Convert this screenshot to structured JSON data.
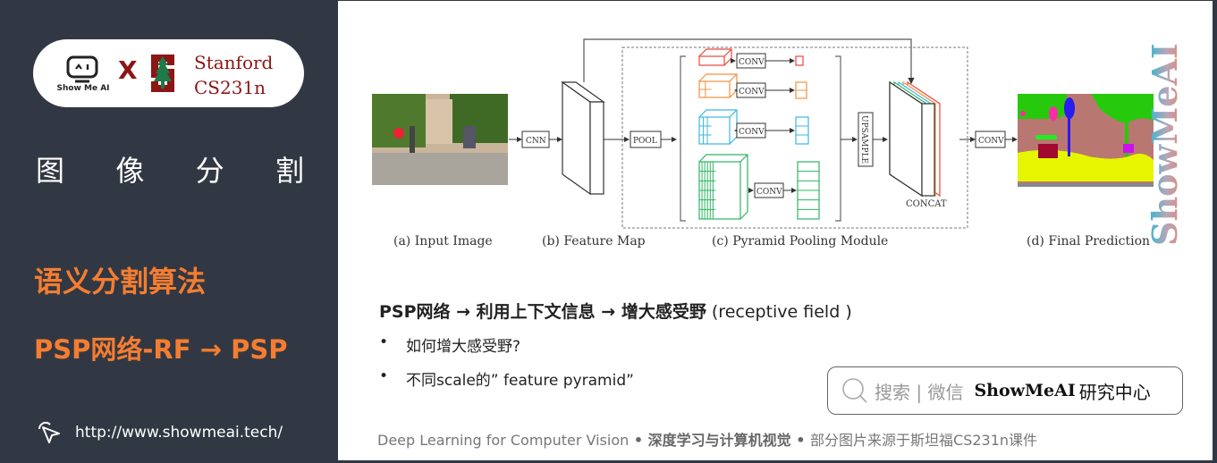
{
  "sidebar": {
    "logo": {
      "showmeai_text": "Show Me AI",
      "x_mark": "X",
      "stanford_line1": "Stanford",
      "stanford_line2": "CS231n"
    },
    "section_title_chars": [
      "图",
      "像",
      "分",
      "割"
    ],
    "topic": "语义分割算法",
    "subtopic": "PSP网络-RF → PSP",
    "site_url": "http://www.showmeai.tech/",
    "icons": {
      "link": "cursor-click-icon"
    },
    "colors": {
      "background": "#323843",
      "accent": "#f47d31",
      "stanford": "#8c1515"
    }
  },
  "slide": {
    "diagram": {
      "captions": {
        "input": "(a) Input Image",
        "feature": "(b) Feature Map",
        "ppm": "(c) Pyramid Pooling Module",
        "final": "(d) Final Prediction"
      },
      "labels": {
        "cnn": "CNN",
        "pool": "POOL",
        "conv": "CONV",
        "upsample": "UPSAMPLE",
        "concat": "CONCAT"
      },
      "pyramid_colors": [
        "#e8463b",
        "#f4913b",
        "#3bb7e8",
        "#2fb463"
      ]
    },
    "watermark": "ShowMeAI",
    "headline": {
      "bold": "PSP网络 → 利用上下文信息 → 增大感受野",
      "normal": " (receptive field )"
    },
    "bullets": [
      "如何增大感受野?",
      "不同scale的” feature pyramid”"
    ],
    "bullet_marker": "•",
    "search": {
      "icon": "search-icon",
      "gray_text": "搜索 | 微信",
      "brand": "ShowMeAI",
      "cn": "研究中心"
    },
    "footer": {
      "part1": "Deep Learning for Computer Vision",
      "sep": " • ",
      "part2": "深度学习与计算机视觉",
      "part3": "部分图片来源于斯坦福CS231n课件"
    }
  }
}
